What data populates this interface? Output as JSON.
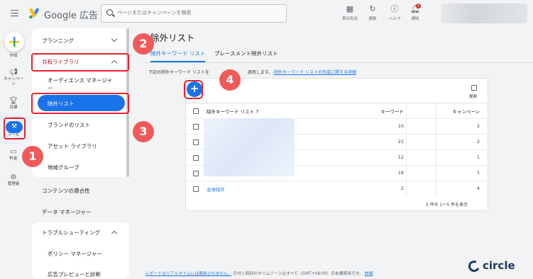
{
  "app": {
    "brand": "Google 広告"
  },
  "search": {
    "placeholder": "ページまたはキャンペーンを検索"
  },
  "top_tools": [
    {
      "label": "表示形式"
    },
    {
      "label": "更新"
    },
    {
      "label": "ヘルプ"
    },
    {
      "label": "通知",
      "badge": "1"
    }
  ],
  "rail": [
    {
      "label": "作成"
    },
    {
      "label": "キャンペーン"
    },
    {
      "label": "目標"
    },
    {
      "label": "ツール"
    },
    {
      "label": "料金"
    },
    {
      "label": "管理者"
    }
  ],
  "sidebar": {
    "planning": "プランニング",
    "shared_library": "共有ライブラリ",
    "shared_items": [
      "オーディエンス マネージャー",
      "除外リスト",
      "ブランドのリスト",
      "アセット ライブラリ",
      "地域グループ"
    ],
    "content_suitability": "コンテンツの適合性",
    "data_manager": "データ マネージャー",
    "troubleshooting": "トラブルシューティング",
    "troubleshooting_items": [
      "ポリシー マネージャー",
      "広告プレビューと診断"
    ]
  },
  "main": {
    "title": "除外リスト",
    "tabs": [
      "除外キーワード リスト",
      "プレースメント除外リスト"
    ],
    "description_prefix": "下記の除外キーワード リストを",
    "description_mid": "適用します。",
    "description_link": "除外キーワード リストの作成に関する詳細",
    "expand_label": "展開",
    "table": {
      "headers": {
        "name": "除外キーワード リスト ↑",
        "keywords": "キーワード",
        "campaigns": "キャンペーン"
      },
      "rows": [
        {
          "name": "",
          "keywords": "10",
          "campaigns": "2"
        },
        {
          "name": "",
          "keywords": "21",
          "campaigns": "2"
        },
        {
          "name": "",
          "keywords": "12",
          "campaigns": "1"
        },
        {
          "name": "",
          "keywords": "18",
          "campaigns": "1"
        },
        {
          "name": "全体除外",
          "keywords": "2",
          "campaigns": "4"
        }
      ]
    },
    "pager": "5 件中 1～5 件を表示"
  },
  "footer": {
    "link": "レポートはリアルタイムには更新されません。",
    "text": "日付と時刻のタイムゾーンはすべて（GMT+09:00）日本標準時です。",
    "link2": "詳細"
  },
  "annotations": [
    "1",
    "2",
    "3",
    "4"
  ],
  "watermark": "circle",
  "colors": {
    "accent": "#1a73e8",
    "annotation": "#f05a5a",
    "highlight": "#e8212e"
  }
}
